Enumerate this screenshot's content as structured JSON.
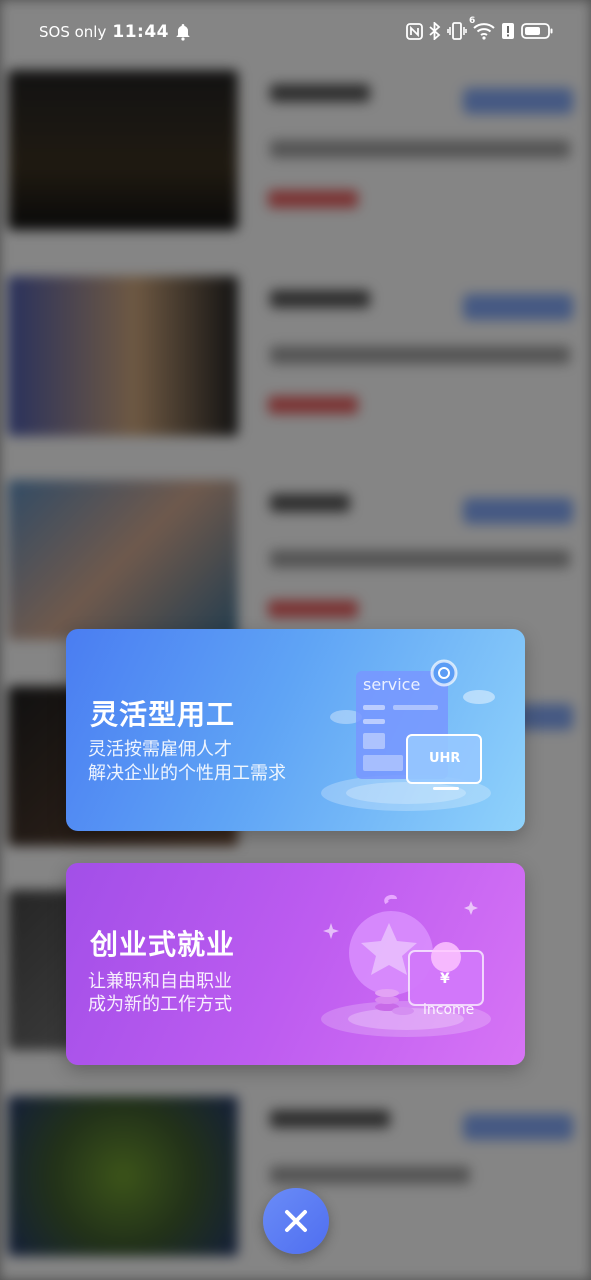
{
  "status_bar": {
    "carrier": "SOS only",
    "time": "11:44",
    "network_badge": "6"
  },
  "cards": [
    {
      "title": "灵活型用工",
      "subtitle_line1": "灵活按需雇佣人才",
      "subtitle_line2": "解决企业的个性用工需求",
      "illustration_label_top": "service",
      "illustration_label_box": "UHR",
      "accent": "#4a7df2"
    },
    {
      "title": "创业式就业",
      "subtitle_line1": "让兼职和自由职业",
      "subtitle_line2": "成为新的工作方式",
      "illustration_label": "income",
      "illustration_symbol": "¥",
      "accent": "#b056ee"
    }
  ],
  "icons": {
    "alarm": "bell-icon",
    "nfc": "nfc-icon",
    "bluetooth": "bluetooth-icon",
    "vibrate": "vibrate-icon",
    "wifi": "wifi-icon",
    "alert": "alert-icon",
    "battery": "battery-icon",
    "close": "close-icon"
  }
}
